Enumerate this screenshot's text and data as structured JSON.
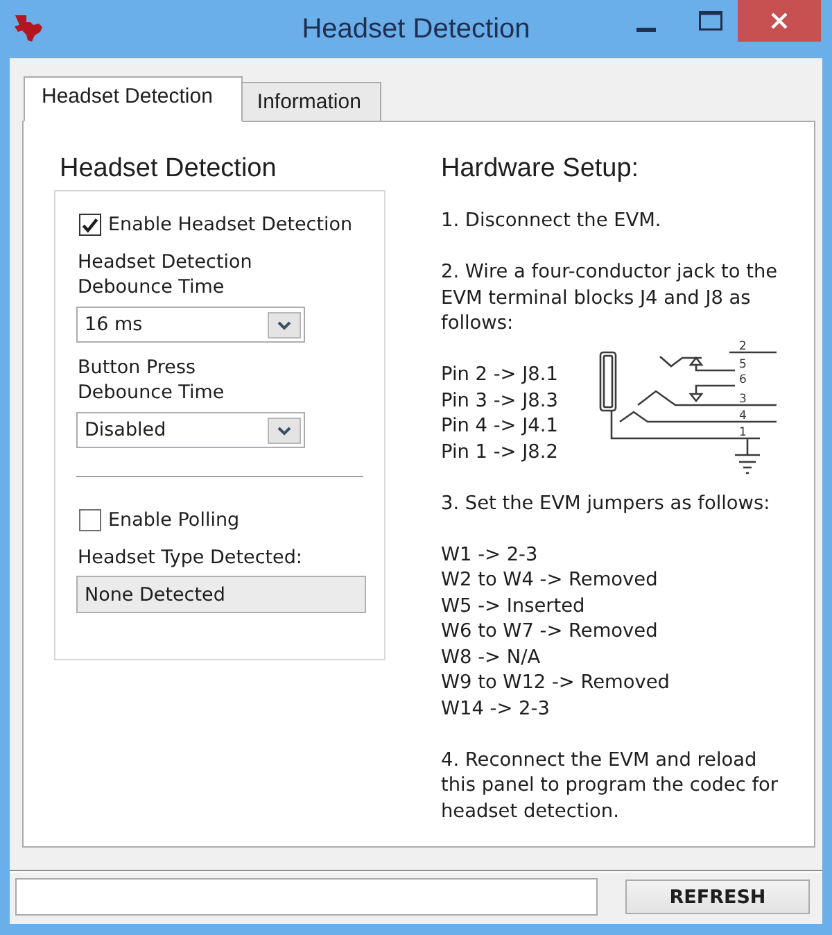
{
  "window": {
    "title": "Headset Detection"
  },
  "tabs": [
    {
      "label": "Headset Detection",
      "selected": true
    },
    {
      "label": "Information",
      "selected": false
    }
  ],
  "headset_detection": {
    "title": "Headset Detection",
    "controls": [
      {
        "kind": "checkbox",
        "label": "Enable Headset Detection",
        "checked": true
      },
      {
        "kind": "dropdown",
        "label": "Headset Detection\nDebounce Time",
        "value": "16 ms"
      },
      {
        "kind": "dropdown",
        "label": "Button Press\nDebounce Time",
        "value": "Disabled"
      },
      {
        "kind": "separator"
      },
      {
        "kind": "checkbox",
        "label": "Enable Polling",
        "checked": false
      },
      {
        "kind": "readout",
        "label": "Headset Type Detected:",
        "value": "None Detected"
      }
    ]
  },
  "hardware_setup": {
    "title": "Hardware Setup:",
    "blocks": [
      {
        "kind": "paragraph",
        "text": "1. Disconnect the EVM."
      },
      {
        "kind": "paragraph",
        "text": "2. Wire a four-conductor jack to the\nEVM terminal blocks J4 and J8 as\nfollows:"
      },
      {
        "kind": "pin_map",
        "lines": [
          "Pin 2 -> J8.1",
          "Pin 3 -> J8.3",
          "Pin 4 -> J4.1",
          "Pin 1 -> J8.2"
        ],
        "diagram_labels": [
          "2",
          "5",
          "6",
          "3",
          "4",
          "1"
        ]
      },
      {
        "kind": "paragraph",
        "text": "3. Set the EVM jumpers as follows:"
      },
      {
        "kind": "list",
        "lines": [
          "W1 -> 2-3",
          "W2 to W4 -> Removed",
          "W5 -> Inserted",
          "W6 to W7 -> Removed",
          "W8 -> N/A",
          "W9 to W12 -> Removed",
          "W14 -> 2-3"
        ]
      },
      {
        "kind": "paragraph",
        "text": "4. Reconnect the EVM and reload\nthis panel to program the codec for\nheadset detection."
      }
    ]
  },
  "footer": {
    "refresh_button": "REFRESH"
  }
}
